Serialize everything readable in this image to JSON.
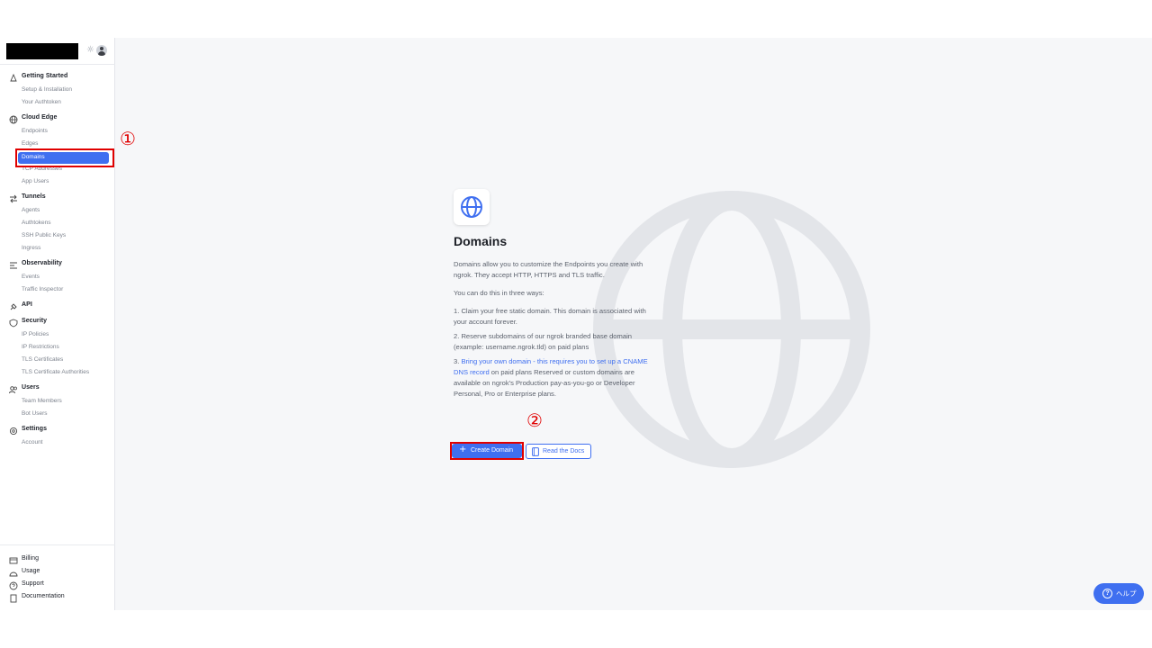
{
  "sidebar": {
    "sections": [
      {
        "label": "Getting Started",
        "icon": "rocket-icon",
        "items": [
          {
            "label": "Setup & Installation"
          },
          {
            "label": "Your Authtoken"
          }
        ]
      },
      {
        "label": "Cloud Edge",
        "icon": "globe-icon",
        "items": [
          {
            "label": "Endpoints"
          },
          {
            "label": "Edges"
          },
          {
            "label": "Domains",
            "active": true
          },
          {
            "label": "TCP Addresses"
          },
          {
            "label": "App Users"
          }
        ]
      },
      {
        "label": "Tunnels",
        "icon": "arrows-icon",
        "items": [
          {
            "label": "Agents"
          },
          {
            "label": "Authtokens"
          },
          {
            "label": "SSH Public Keys"
          },
          {
            "label": "Ingress"
          }
        ]
      },
      {
        "label": "Observability",
        "icon": "list-icon",
        "items": [
          {
            "label": "Events"
          },
          {
            "label": "Traffic Inspector"
          }
        ]
      },
      {
        "label": "API",
        "icon": "plug-icon",
        "items": []
      },
      {
        "label": "Security",
        "icon": "shield-icon",
        "items": [
          {
            "label": "IP Policies"
          },
          {
            "label": "IP Restrictions"
          },
          {
            "label": "TLS Certificates"
          },
          {
            "label": "TLS Certificate Authorities"
          }
        ]
      },
      {
        "label": "Users",
        "icon": "users-icon",
        "items": [
          {
            "label": "Team Members"
          },
          {
            "label": "Bot Users"
          }
        ]
      },
      {
        "label": "Settings",
        "icon": "gear-icon",
        "items": [
          {
            "label": "Account"
          }
        ]
      }
    ],
    "bottom": [
      {
        "label": "Billing",
        "icon": "card-icon"
      },
      {
        "label": "Usage",
        "icon": "gauge-icon"
      },
      {
        "label": "Support",
        "icon": "help-circle-icon"
      },
      {
        "label": "Documentation",
        "icon": "book-icon"
      }
    ]
  },
  "annotations": {
    "marker1": "①",
    "marker2": "②"
  },
  "main": {
    "title": "Domains",
    "intro": "Domains allow you to customize the Endpoints you create with ngrok. They accept HTTP, HTTPS and TLS traffic.",
    "ways_heading": "You can do this in three ways:",
    "way1": "1. Claim your free static domain. This domain is associated with your account forever.",
    "way2": "2. Reserve subdomains of our ngrok branded base domain (example: username.ngrok.tld) on paid plans",
    "way3_prefix": "3. ",
    "way3_link1": "Bring your own domain",
    "way3_link2": " - this requires you to set up a CNAME DNS record",
    "way3_suffix": " on paid plans Reserved or custom domains are available on ngrok's Production pay-as-you-go or Developer Personal, Pro or Enterprise plans.",
    "create_button": "Create Domain",
    "docs_button": "Read the Docs"
  },
  "help_button": "ヘルプ",
  "colors": {
    "accent": "#3f6ff0",
    "annotation": "#e00000"
  }
}
